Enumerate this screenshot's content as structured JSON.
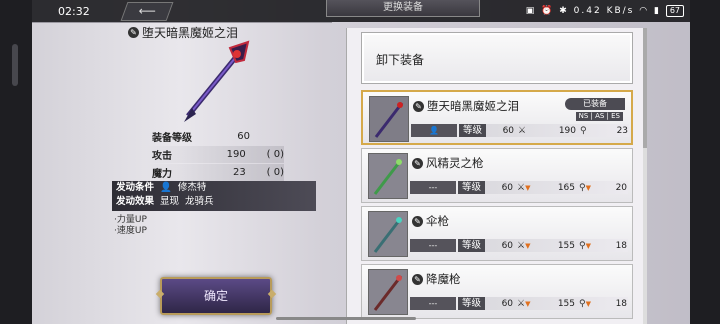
{
  "status_bar": {
    "time": "02:32",
    "speed": "0.42 KB/s",
    "battery": "67"
  },
  "header": {
    "title": "更换装备",
    "back_icon": "arrow-left-icon"
  },
  "weapon_detail": {
    "name": "堕天暗黑魔姬之泪",
    "stats": [
      {
        "label": "装备等级",
        "value": "60",
        "bonus": ""
      },
      {
        "label": "攻击",
        "value": "190",
        "bonus": "(        0)"
      },
      {
        "label": "魔力",
        "value": "23",
        "bonus": "(        0)"
      }
    ],
    "condition_label": "发动条件",
    "condition_value": "修杰特",
    "effect_label": "发动效果",
    "effect_value_1": "显现",
    "effect_value_2": "龙骑兵",
    "bonuses": [
      "·力量UP",
      "·速度UP"
    ]
  },
  "confirm_label": "确定",
  "list": {
    "unequip_label": "卸下装备",
    "items": [
      {
        "name": "堕天暗黑魔姬之泪",
        "owner": "",
        "level_label": "等级",
        "level": "60",
        "atk": "190",
        "mag": "23",
        "equipped": "已装备",
        "tag": "NS | AS | ES"
      },
      {
        "name": "风精灵之枪",
        "owner": "---",
        "level_label": "等级",
        "level": "60",
        "atk": "165",
        "mag": "20"
      },
      {
        "name": "伞枪",
        "owner": "---",
        "level_label": "等级",
        "level": "60",
        "atk": "155",
        "mag": "18"
      },
      {
        "name": "降魔枪",
        "owner": "---",
        "level_label": "等级",
        "level": "60",
        "atk": "155",
        "mag": "18"
      }
    ]
  }
}
